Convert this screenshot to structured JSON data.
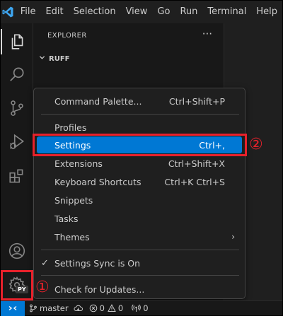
{
  "menubar": {
    "items": [
      "File",
      "Edit",
      "Selection",
      "View",
      "Go",
      "Run",
      "Terminal",
      "Help"
    ]
  },
  "activity_bar": {
    "icons": [
      "explorer-icon",
      "search-icon",
      "source-control-icon",
      "run-debug-icon",
      "extensions-icon",
      "accounts-icon",
      "manage-gear-icon"
    ],
    "manage_badge": "PY"
  },
  "sidebar": {
    "title": "EXPLORER",
    "more": "···",
    "folder": "RUFF"
  },
  "context_menu": {
    "command_palette": {
      "label": "Command Palette...",
      "shortcut": "Ctrl+Shift+P"
    },
    "profiles": {
      "label": "Profiles"
    },
    "settings": {
      "label": "Settings",
      "shortcut": "Ctrl+,"
    },
    "extensions": {
      "label": "Extensions",
      "shortcut": "Ctrl+Shift+X"
    },
    "keyboard_shortcuts": {
      "label": "Keyboard Shortcuts",
      "shortcut": "Ctrl+K Ctrl+S"
    },
    "snippets": {
      "label": "Snippets"
    },
    "tasks": {
      "label": "Tasks"
    },
    "themes": {
      "label": "Themes",
      "arrow": "›"
    },
    "settings_sync": {
      "label": "Settings Sync is On",
      "check": "✓"
    },
    "check_updates": {
      "label": "Check for Updates..."
    }
  },
  "statusbar": {
    "branch": "master",
    "errors": "0",
    "warnings": "0",
    "ports": "0"
  },
  "annotations": {
    "step1": "①",
    "step2": "②"
  },
  "colors": {
    "accent": "#0078d4",
    "annotation": "#e8212b"
  }
}
